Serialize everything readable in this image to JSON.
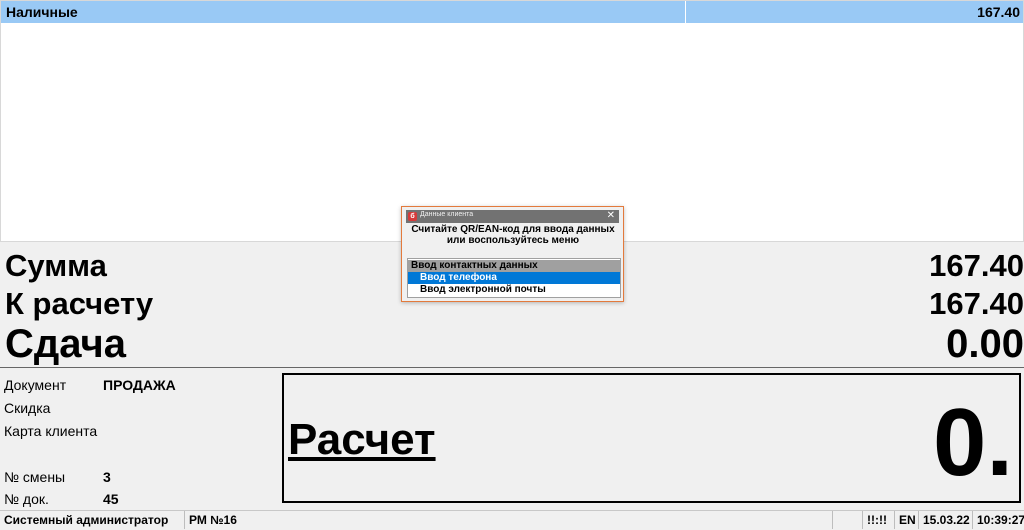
{
  "payments": {
    "rows": [
      {
        "name": "Наличные",
        "amount": "167.40"
      }
    ]
  },
  "totals": {
    "sum_label": "Сумма",
    "sum_value": "167.40",
    "due_label": "К расчету",
    "due_value": "167.40",
    "change_label": "Сдача",
    "change_value": "0.00"
  },
  "info": {
    "document_label": "Документ",
    "document_value": "ПРОДАЖА",
    "discount_label": "Скидка",
    "card_label": "Карта клиента",
    "shift_label": "№ смены",
    "shift_value": "3",
    "doc_no_label": "№ док.",
    "doc_no_value": "45"
  },
  "calc": {
    "label": "Расчет",
    "amount": "0."
  },
  "status": {
    "user": "Системный администратор",
    "workplace": "РМ №16",
    "indicator": "!!:!!",
    "lang": "EN",
    "date": "15.03.22",
    "time": "10:39:27"
  },
  "dialog": {
    "title": "Данные клиента",
    "message": "Считайте QR/EAN-код для ввода данных или воспользуйтесь меню",
    "menu": {
      "header": "Ввод контактных данных",
      "items": [
        "Ввод телефона",
        "Ввод электронной почты"
      ],
      "selected_index": 0
    }
  },
  "colors": {
    "selected_row": "#99c9f5",
    "menu_selected": "#0078d7",
    "dialog_border": "#e37a3c",
    "dialog_title_bar": "#727272"
  }
}
